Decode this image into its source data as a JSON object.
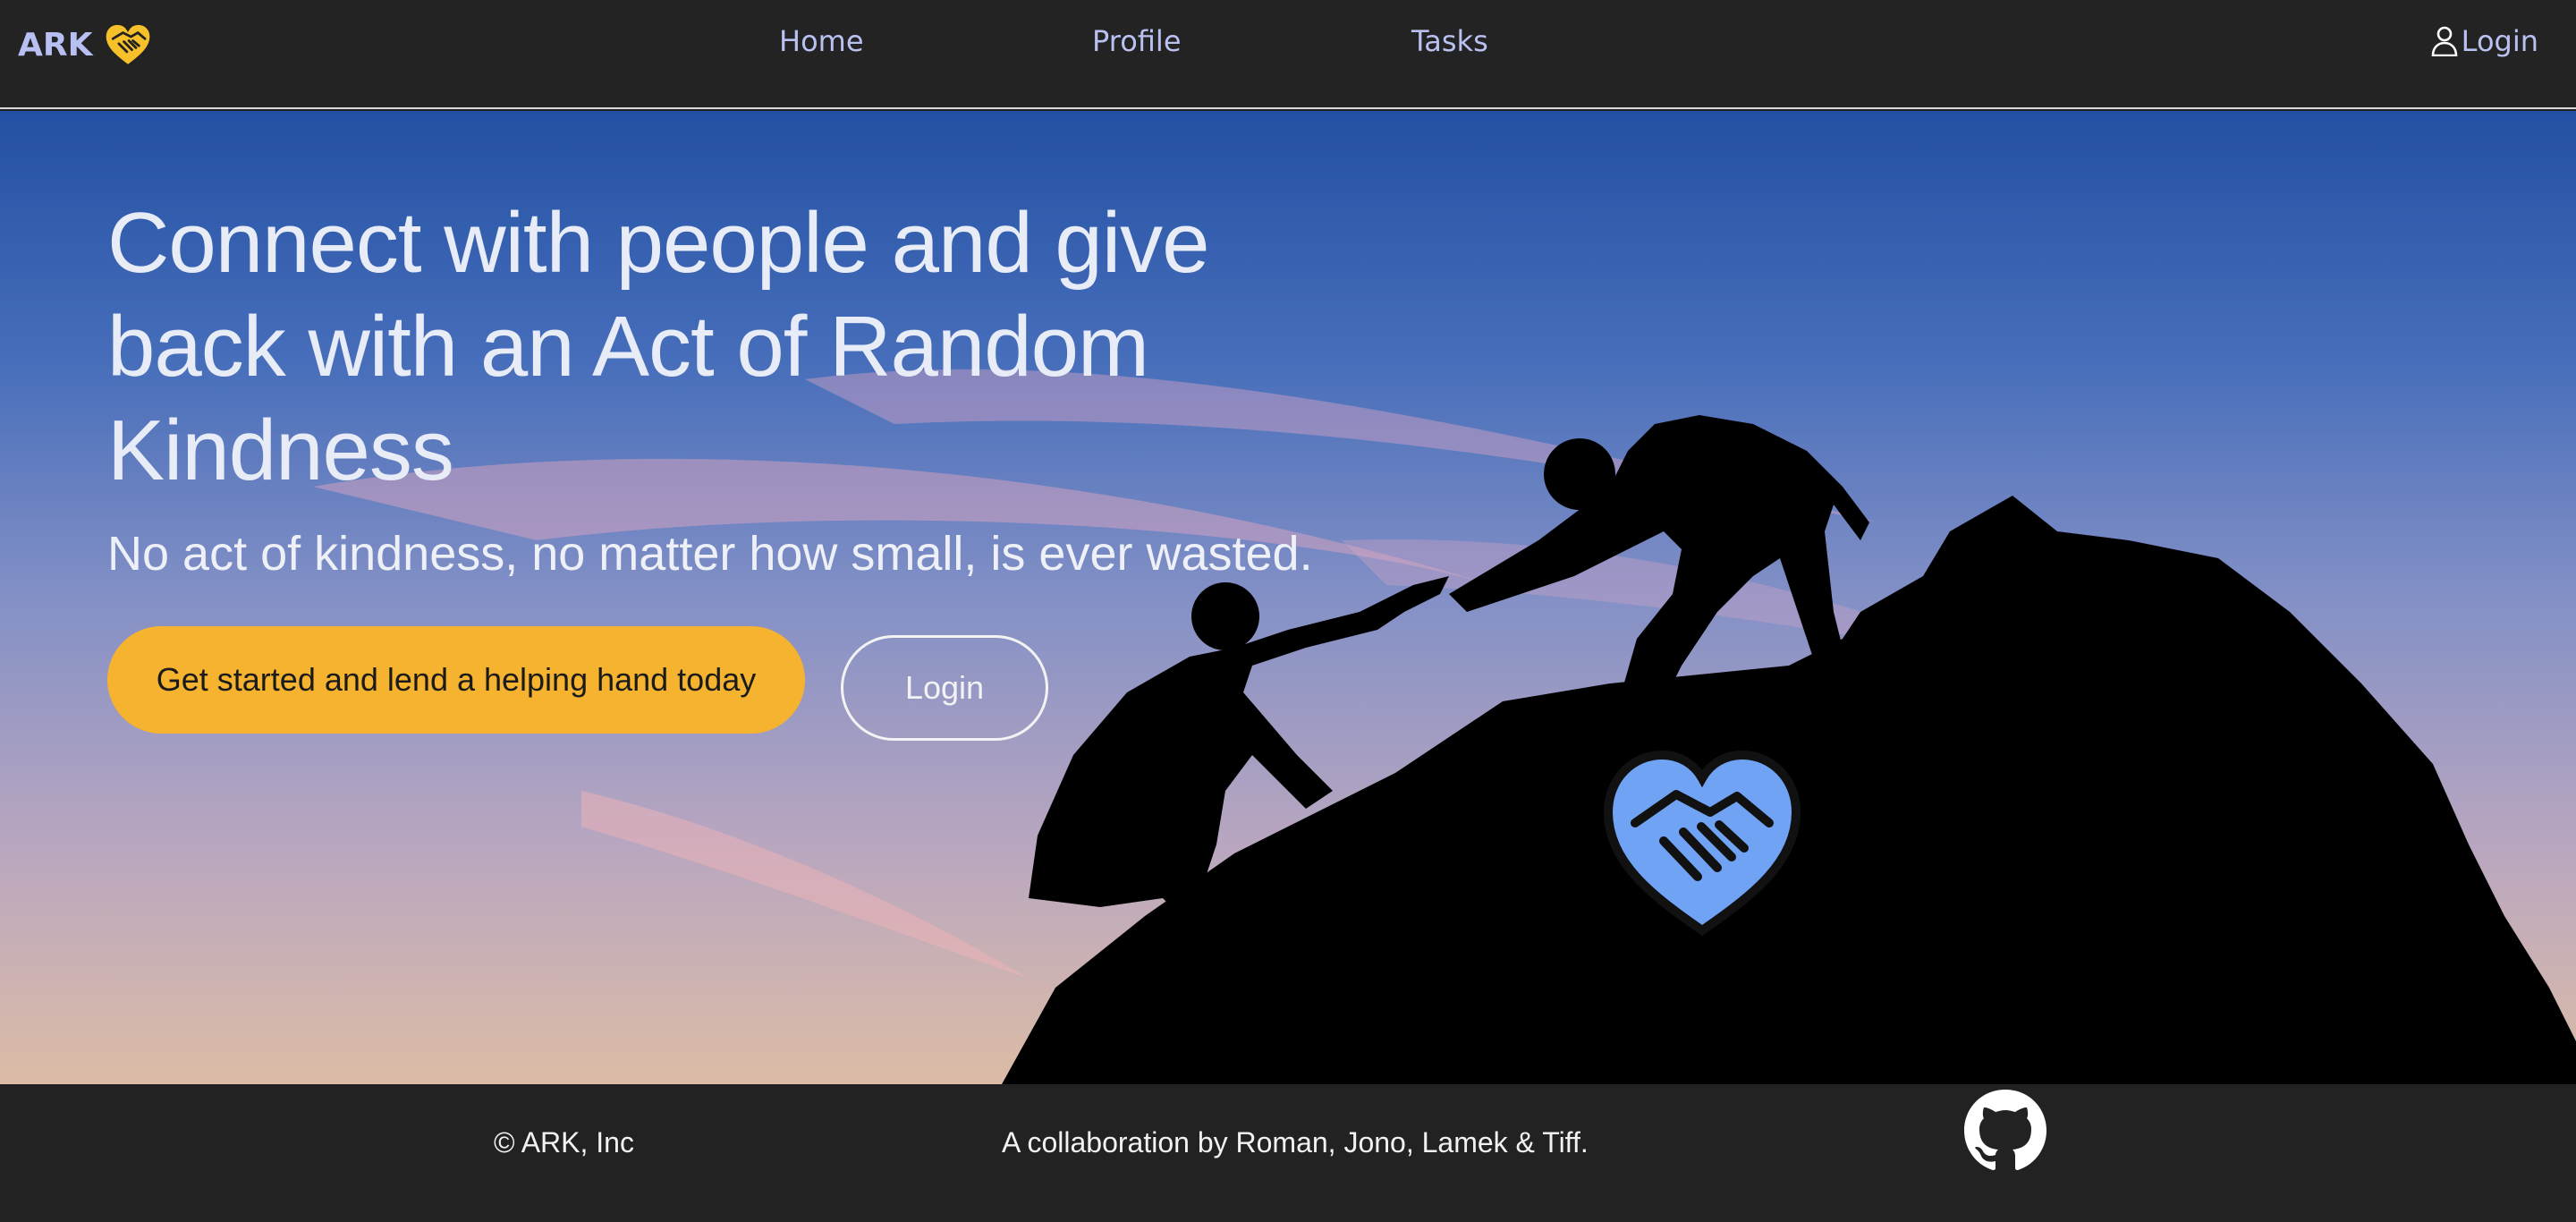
{
  "nav": {
    "brand": "ARK",
    "brand_icon": "heart-handshake-icon",
    "links": [
      "Home",
      "Profile",
      "Tasks"
    ],
    "login_label": "Login",
    "login_icon": "person-icon",
    "text_color": "#b9c1f1"
  },
  "hero": {
    "title": "Connect with people and give back with an Act of Random Kindness",
    "subtitle": "No act of kindness, no matter how small, is ever wasted.",
    "primary_button": "Get started and lend a helping hand today",
    "secondary_button": "Login",
    "background": "sunset-sky-climbers-silhouette",
    "logo_icon": "heart-handshake-icon",
    "accent_color": "#f5b330",
    "logo_color": "#6ea2f5"
  },
  "footer": {
    "copyright": "© ARK, Inc",
    "collaboration": "A collaboration by Roman, Jono, Lamek & Tiff.",
    "github_icon": "github-icon"
  }
}
